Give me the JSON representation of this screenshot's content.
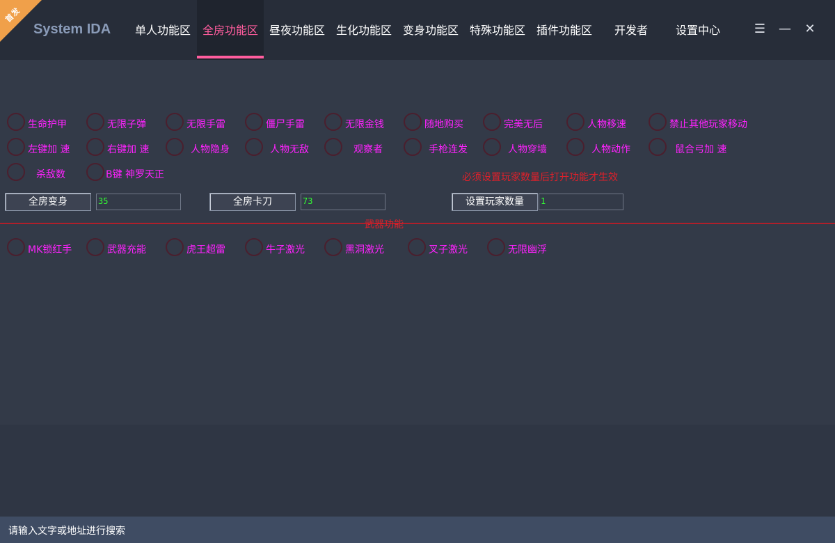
{
  "app": {
    "title": "System IDA",
    "corner_badge": "首发"
  },
  "tabs": [
    {
      "label": "单人功能区"
    },
    {
      "label": "全房功能区"
    },
    {
      "label": "昼夜功能区"
    },
    {
      "label": "生化功能区"
    },
    {
      "label": "变身功能区"
    },
    {
      "label": "特殊功能区"
    },
    {
      "label": "插件功能区"
    },
    {
      "label": "开发者"
    },
    {
      "label": "设置中心"
    }
  ],
  "active_tab": "全房功能区",
  "window_controls": {
    "menu": "☰",
    "minimize": "—",
    "close": "✕"
  },
  "options_row1": [
    "生命护甲",
    "无限子弹",
    "无限手雷",
    "僵尸手雷",
    "无限金钱",
    "随地购买",
    "完美无后",
    "人物移速",
    "禁止其他玩家移动"
  ],
  "options_row2": [
    "左键加 速",
    "右键加 速",
    "人物隐身",
    "人物无敌",
    "观察者",
    "手枪连发",
    "人物穿墙",
    "人物动作",
    "鼠合弓加 速"
  ],
  "options_row3": [
    "杀敌数",
    "B键 神罗天正"
  ],
  "notice": "必须设置玩家数量后打开功能才生效",
  "actions": {
    "transform_all": {
      "label": "全房变身",
      "value": "35"
    },
    "knife_all": {
      "label": "全房卡刀",
      "value": "73"
    },
    "player_count": {
      "label": "设置玩家数量",
      "value": "1"
    }
  },
  "weapon_section_label": "武器功能",
  "weapon_options": [
    "MK锁红手",
    "武器充能",
    "虎王超雷",
    "牛子激光",
    "黑洞激光",
    "叉子激光",
    "无限幽浮"
  ],
  "status_bar": {
    "search_hint": "请输入文字或地址进行搜索"
  },
  "colors": {
    "background": "#333a48",
    "topbar": "#272d39",
    "accent": "#ff5d9e",
    "option_text": "#ff22ff",
    "warning": "#e0202a",
    "input_text": "#33ff33"
  }
}
